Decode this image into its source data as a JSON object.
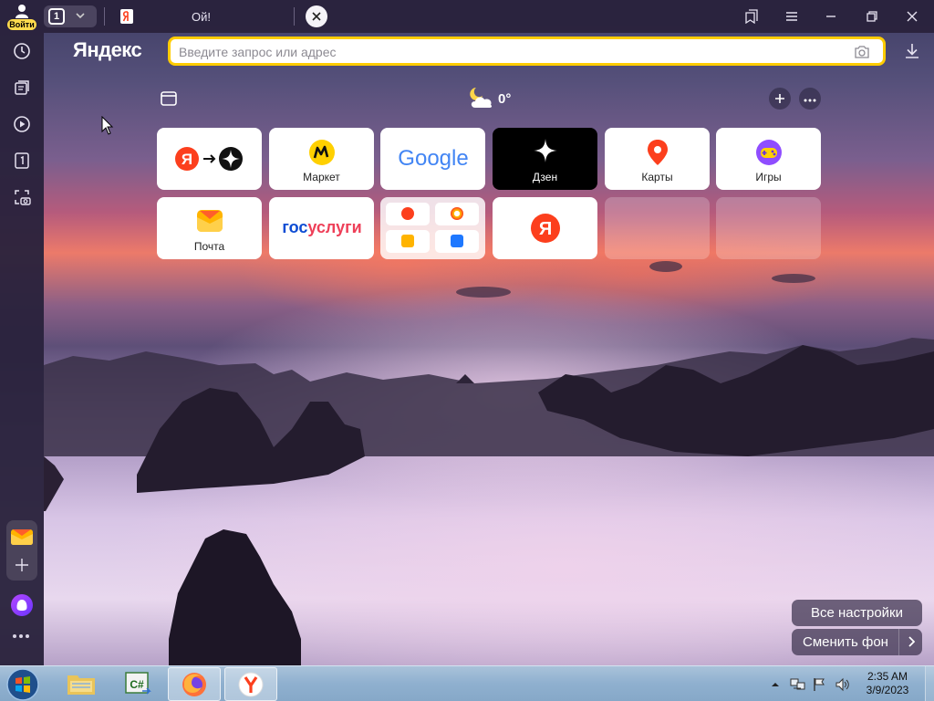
{
  "titlebar": {
    "profile_label": "Войти",
    "tab_count": "1",
    "tab_title": "Ой!"
  },
  "browser": {
    "brand": "Яндекс",
    "address_placeholder": "Введите запрос или адрес"
  },
  "widgets": {
    "temperature": "0°"
  },
  "tiles": [
    {
      "label": "",
      "icon": "yandex-to-zen-icon"
    },
    {
      "label": "Маркет",
      "icon": "market-icon"
    },
    {
      "label": "",
      "icon": "google-logo"
    },
    {
      "label": "Дзен",
      "icon": "zen-star-icon"
    },
    {
      "label": "Карты",
      "icon": "map-pin-icon"
    },
    {
      "label": "Игры",
      "icon": "gamepad-icon"
    },
    {
      "label": "Почта",
      "icon": "mail-icon"
    },
    {
      "label": "",
      "icon": "gosuslugi-logo"
    },
    {
      "label": "",
      "icon": "folder-icon"
    },
    {
      "label": "",
      "icon": "yandex-icon"
    }
  ],
  "tile_logos": {
    "google": "Google",
    "gosuslugi_a": "гос",
    "gosuslugi_b": "услуги",
    "yandex_letter": "Я"
  },
  "actions": {
    "all_settings": "Все настройки",
    "change_background": "Сменить фон"
  },
  "taskbar": {
    "time": "2:35 AM",
    "date": "3/9/2023",
    "csharp_label": "C#"
  },
  "colors": {
    "accent_yellow": "#ffcc00",
    "yandex_red": "#fc3f1d",
    "sidebar_bg": "#2a223c"
  }
}
